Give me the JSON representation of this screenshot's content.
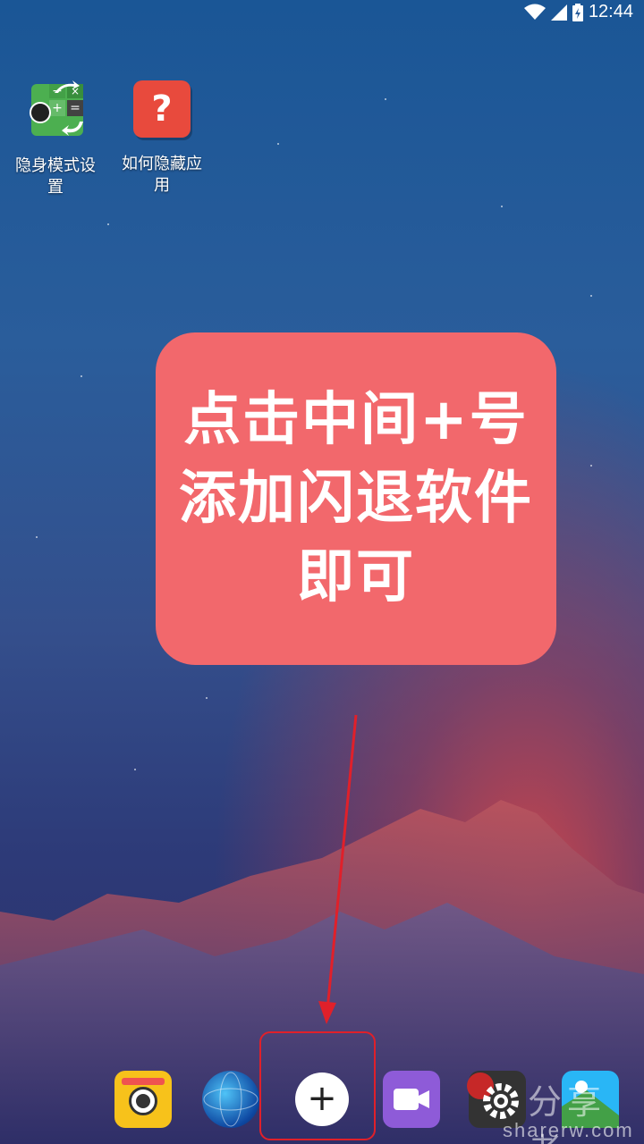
{
  "status_bar": {
    "time": "12:44"
  },
  "desktop_apps": [
    {
      "label": "隐身模式设置"
    },
    {
      "label": "如何隐藏应用"
    }
  ],
  "callout": {
    "lines": [
      "点击中间+号",
      "添加闪退软件",
      "即可"
    ]
  },
  "dock": {
    "apps": [
      "camera-app-icon",
      "globe-app-icon",
      "video-app-icon",
      "settings-app-icon",
      "gallery-app-icon"
    ],
    "add_symbol": "+"
  },
  "watermark": {
    "title": "分享者",
    "url": "sharerw.com"
  },
  "colors": {
    "callout_bg": "#f2686c",
    "arrow": "#e0202a"
  }
}
